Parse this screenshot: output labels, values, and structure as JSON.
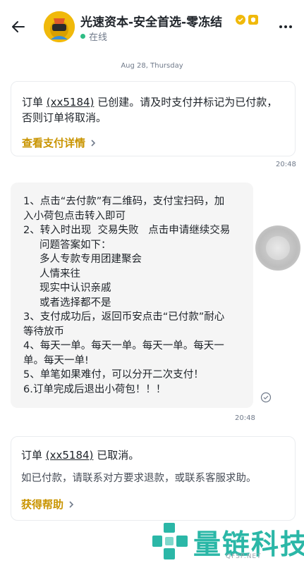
{
  "header": {
    "title": "光速资本-安全首选-零冻结",
    "status": "在线",
    "back_icon": "arrow-left-icon",
    "more_icon": "more-horizontal-icon"
  },
  "date_separator": "Aug 28, Thursday",
  "order_card": {
    "prefix": "订单 ",
    "order_id": "(xx5184)",
    "text": " 已创建。请及时支付并标记为已付款，否则订单将取消。",
    "link": "查看支付详情",
    "time": "20:48"
  },
  "message": {
    "lines": [
      "1、点击“去付款”有二维码，支付宝扫码，加",
      "入小荷包点击转入即可",
      "2、转入时出现  交易失败   点击申请继续交易",
      "     问题答案如下：",
      "     多人专款专用团建聚会",
      "     人情来往",
      "     现实中认识亲戚",
      "     或者选择都不是",
      "3、支付成功后，返回币安点击“已付款”耐心",
      "等待放币",
      "4、每天一单。每天一单。每天一单。每天一",
      "单。每天一单!",
      "5、单笔如果难付，可以分开二次支付！",
      "6.订单完成后退出小荷包！！！"
    ],
    "time": "20:48"
  },
  "cancel_card": {
    "prefix": "订单 ",
    "order_id": "(xx5184)",
    "text": " 已取消。",
    "sub": "如已付款，请联系对方要求退款，或联系客服求助。",
    "link": "获得帮助"
  },
  "watermark": {
    "text": "量链科技",
    "sub": "QFSP.NET"
  },
  "colors": {
    "accent": "#c99400",
    "brand_yellow": "#f0b90b",
    "online": "#2ebd85",
    "watermark": "#2bb7a7"
  }
}
